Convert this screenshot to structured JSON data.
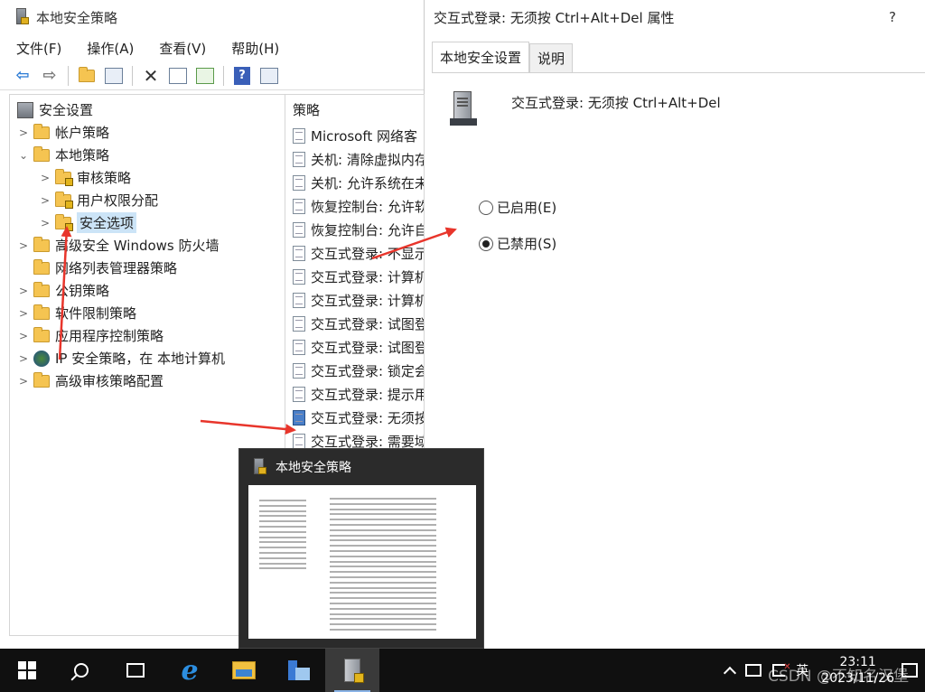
{
  "mmc": {
    "title": "本地安全策略",
    "menu": [
      "文件(F)",
      "操作(A)",
      "查看(V)",
      "帮助(H)"
    ],
    "tree": [
      {
        "label": "安全设置",
        "level": 0,
        "chevron": "",
        "icon": "root"
      },
      {
        "label": "帐户策略",
        "level": 1,
        "chevron": ">",
        "icon": "folder"
      },
      {
        "label": "本地策略",
        "level": 1,
        "chevron": "v",
        "icon": "folder"
      },
      {
        "label": "审核策略",
        "level": 2,
        "chevron": ">",
        "icon": "folder-lock"
      },
      {
        "label": "用户权限分配",
        "level": 2,
        "chevron": ">",
        "icon": "folder-lock"
      },
      {
        "label": "安全选项",
        "level": 2,
        "chevron": ">",
        "icon": "folder-lock",
        "selected": true
      },
      {
        "label": "高级安全 Windows 防火墙",
        "level": 1,
        "chevron": ">",
        "icon": "folder"
      },
      {
        "label": "网络列表管理器策略",
        "level": 1,
        "chevron": "",
        "icon": "folder"
      },
      {
        "label": "公钥策略",
        "level": 1,
        "chevron": ">",
        "icon": "folder"
      },
      {
        "label": "软件限制策略",
        "level": 1,
        "chevron": ">",
        "icon": "folder"
      },
      {
        "label": "应用程序控制策略",
        "level": 1,
        "chevron": ">",
        "icon": "folder"
      },
      {
        "label": "IP 安全策略，在 本地计算机",
        "level": 1,
        "chevron": ">",
        "icon": "ipsec"
      },
      {
        "label": "高级审核策略配置",
        "level": 1,
        "chevron": ">",
        "icon": "folder"
      }
    ],
    "policy_header": "策略",
    "policies": [
      "Microsoft 网络客",
      "关机: 清除虚拟内存",
      "关机: 允许系统在未",
      "恢复控制台: 允许软",
      "恢复控制台: 允许自",
      "交互式登录: 不显示",
      "交互式登录: 计算机",
      "交互式登录: 计算机",
      "交互式登录: 试图登",
      "交互式登录: 试图登",
      "交互式登录: 锁定会",
      "交互式登录: 提示用",
      "交互式登录: 无须按",
      "交互式登录: 需要域"
    ],
    "active_policy_index": 12
  },
  "dialog": {
    "title": "交互式登录: 无须按 Ctrl+Alt+Del 属性",
    "help": "?",
    "tabs": [
      "本地安全设置",
      "说明"
    ],
    "policy_name": "交互式登录: 无须按 Ctrl+Alt+Del",
    "options": [
      {
        "label": "已启用(E)",
        "checked": false
      },
      {
        "label": "已禁用(S)",
        "checked": true
      }
    ]
  },
  "thumbnail": {
    "title": "本地安全策略"
  },
  "taskbar": {
    "ime": "英",
    "time": "23:11",
    "date": "2023/11/26"
  },
  "watermark": "CSDN @不知名汉堡",
  "colors": {
    "selection": "#cce4f7",
    "annotation_arrow": "#e8352b",
    "taskbar": "#101010"
  }
}
